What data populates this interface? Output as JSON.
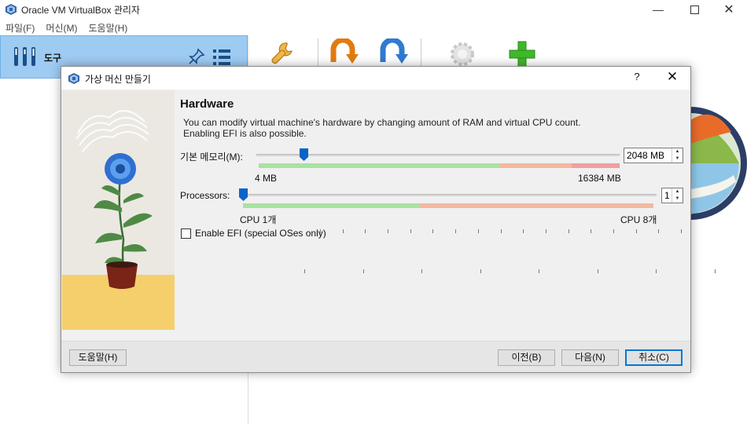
{
  "window": {
    "title": "Oracle VM VirtualBox 관리자"
  },
  "menu": {
    "items": [
      "파일(F)",
      "머신(M)",
      "도움말(H)"
    ]
  },
  "left": {
    "tools_label": "도구"
  },
  "dialog": {
    "title": "가상 머신 만들기",
    "help_symbol": "?",
    "close_symbol": "✕",
    "section_title": "Hardware",
    "description_line1": "You can modify virtual machine's hardware by changing amount of RAM and virtual CPU count.",
    "description_line2": "Enabling EFI is also possible.",
    "memory": {
      "label": "기본 메모리(M):",
      "value": "2048 MB",
      "min_label": "4 MB",
      "max_label": "16384 MB"
    },
    "processors": {
      "label": "Processors:",
      "value": "1",
      "min_label": "CPU 1개",
      "max_label": "CPU 8개"
    },
    "efi": {
      "label": "Enable EFI (special OSes only)",
      "checked": false
    },
    "buttons": {
      "help": "도움말(H)",
      "back": "이전(B)",
      "next": "다음(N)",
      "cancel": "취소(C)"
    }
  },
  "colors": {
    "accent": "#0078d7",
    "tools_highlight": "#9ecbf2",
    "scale_green": "#a8e3a0",
    "scale_orange": "#f3b9a0",
    "scale_red": "#f0a0a0"
  }
}
